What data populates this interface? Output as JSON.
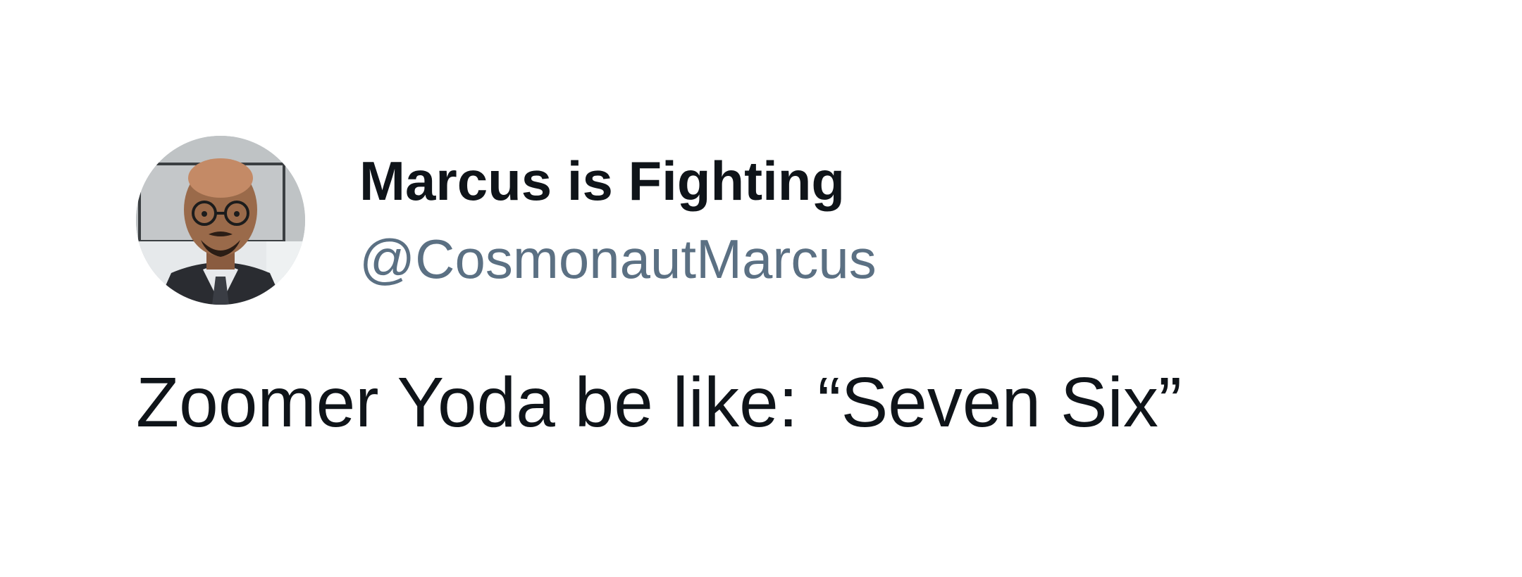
{
  "tweet": {
    "author": {
      "display_name": "Marcus is Fighting",
      "handle": "@CosmonautMarcus",
      "avatar_icon": "profile-photo"
    },
    "text": "Zoomer Yoda be like: “Seven Six”"
  },
  "colors": {
    "background": "#ffffff",
    "text_primary": "#0f1419",
    "text_secondary": "#5b7083"
  }
}
